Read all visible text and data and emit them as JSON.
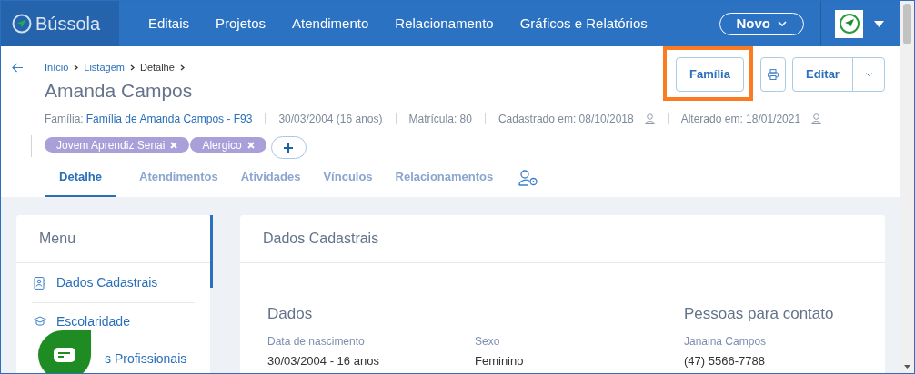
{
  "nav": {
    "logo": "Bússola",
    "items": [
      "Editais",
      "Projetos",
      "Atendimento",
      "Relacionamento",
      "Gráficos e Relatórios"
    ],
    "new_button": "Novo"
  },
  "header": {
    "breadcrumbs": [
      {
        "label": "Início",
        "link": true
      },
      {
        "label": "Listagem",
        "link": true
      },
      {
        "label": "Detalhe",
        "link": false
      }
    ],
    "title": "Amanda Campos",
    "family_label": "Família:",
    "family_link": "Família de Amanda Campos - F93",
    "meta": [
      "30/03/2004 (16 anos)",
      "Matrícula: 80",
      "Cadastrado em: 08/10/2018",
      "Alterado em: 18/01/2021"
    ],
    "tags": [
      {
        "label": "Jovem Aprendiz Senai"
      },
      {
        "label": "Alergico"
      }
    ],
    "tabs": [
      {
        "label": "Detalhe",
        "selected": true
      },
      {
        "label": "Atendimentos",
        "selected": false
      },
      {
        "label": "Atividades",
        "selected": false
      },
      {
        "label": "Vínculos",
        "selected": false
      },
      {
        "label": "Relacionamentos",
        "selected": false
      }
    ],
    "actions": {
      "family_button": {
        "label": "Família",
        "highlighted": true
      },
      "edit_button": "Editar"
    }
  },
  "menu": {
    "title": "Menu",
    "items": [
      {
        "label": "Dados Cadastrais"
      },
      {
        "label": "Escolaridade"
      },
      {
        "label": "s Profissionais"
      }
    ]
  },
  "section": {
    "title": "Dados Cadastrais",
    "columns": [
      {
        "title": "Dados"
      },
      {
        "title": "Pessoas para contato"
      }
    ],
    "fields": [
      {
        "label": "Data de nascimento",
        "value": "30/03/2004 - 16 anos"
      },
      {
        "label": "Sexo",
        "value": "Feminino"
      },
      {
        "label": "Janaina Campos",
        "value": "(47) 5566-7788"
      }
    ]
  }
}
